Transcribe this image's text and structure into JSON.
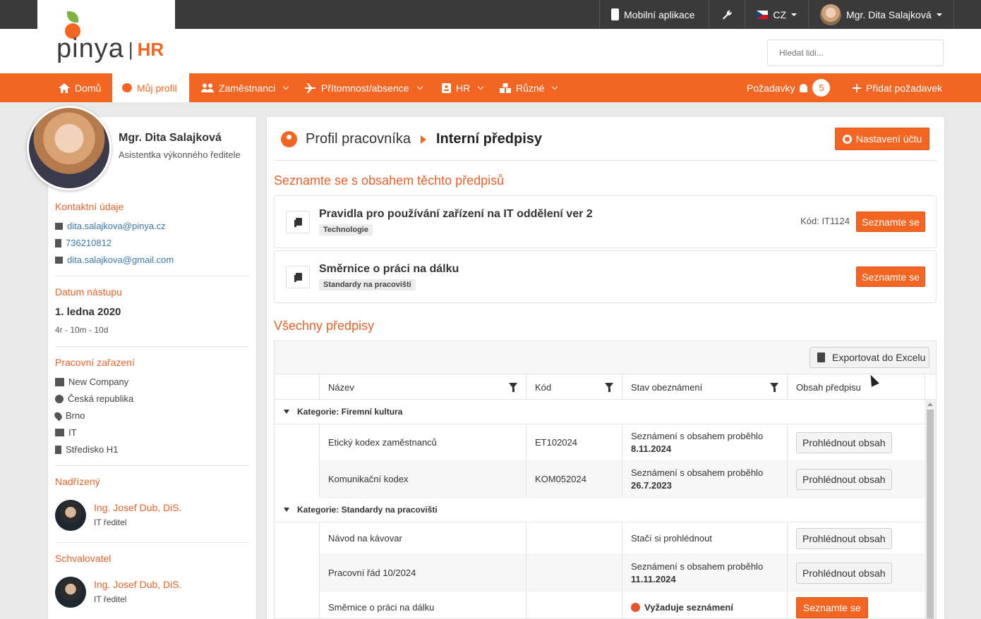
{
  "topbar": {
    "mobile_app": "Mobilní aplikace",
    "language": "CZ",
    "user_name": "Mgr. Dita Salajková"
  },
  "header": {
    "logo_text": "pinya",
    "logo_sep": "|",
    "logo_hr": "HR",
    "search_placeholder": "Hledat lidi..."
  },
  "nav": {
    "items": [
      {
        "label": "Domů"
      },
      {
        "label": "Můj profil"
      },
      {
        "label": "Zaměstnanci"
      },
      {
        "label": "Přítomnost/absence"
      },
      {
        "label": "HR"
      },
      {
        "label": "Různé"
      }
    ],
    "requests_label": "Požadavky",
    "requests_count": "5",
    "add_request_label": "Přidat požadavek",
    "brand_color": "#f26522"
  },
  "profile": {
    "name": "Mgr. Dita Salajková",
    "title": "Asistentka výkonného ředitele",
    "contact_heading": "Kontaktní údaje",
    "email": "dita.salajkova@pinya.cz",
    "phone": "736210812",
    "email_private": "dita.salajkova@gmail.com",
    "start_heading": "Datum nástupu",
    "start_date": "1. ledna 2020",
    "tenure": "4r - 10m - 10d",
    "position_heading": "Pracovní zařazení",
    "company": "New Company",
    "country": "Česká republika",
    "city": "Brno",
    "department": "IT",
    "cost_center": "Středisko H1",
    "manager_heading": "Nadřízený",
    "manager_name": "Ing. Josef Dub, DiS.",
    "manager_role": "IT ředitel",
    "approver_heading": "Schvalovatel",
    "approver_name": "Ing. Josef Dub, DiS.",
    "approver_role": "IT ředitel"
  },
  "main": {
    "crumb1": "Profil pracovníka",
    "crumb2": "Interní předpisy",
    "settings_button": "Nastavení účtu",
    "pending_heading": "Seznamte se s obsahem těchto předpisů",
    "pending": [
      {
        "title": "Pravidla pro používání zařízení na IT oddělení ver 2",
        "tag": "Technologie",
        "code": "Kód: IT1124",
        "button": "Seznamte se"
      },
      {
        "title": "Směrnice o práci na dálku",
        "tag": "Standardy na pracovišti",
        "code": "",
        "button": "Seznamte se"
      }
    ],
    "all_heading": "Všechny předpisy",
    "export_button": "Exportovat do Excelu",
    "columns": [
      "Název",
      "Kód",
      "Stav obeznámení",
      "Obsah předpisu"
    ],
    "categories": [
      {
        "label": "Kategorie: Firemní kultura",
        "rows": [
          {
            "name": "Etický kodex zaměstnanců",
            "code": "ET102024",
            "status_line": "Seznámení s obsahem proběhlo",
            "status_date": "8.11.2024",
            "button": "Prohlédnout obsah"
          },
          {
            "name": "Komunikační kodex",
            "code": "KOM052024",
            "status_line": "Seznámení s obsahem proběhlo",
            "status_date": "26.7.2023",
            "button": "Prohlédnout obsah"
          }
        ]
      },
      {
        "label": "Kategorie: Standardy na pracovišti",
        "rows": [
          {
            "name": "Návod na kávovar",
            "code": "",
            "status_line": "Stačí si prohlédnout",
            "status_date": "",
            "button": "Prohlédnout obsah"
          },
          {
            "name": "Pracovní řád 10/2024",
            "code": "",
            "status_line": "Seznámení s obsahem proběhlo",
            "status_date": "11.11.2024",
            "button": "Prohlédnout obsah"
          },
          {
            "name": "Směrnice o práci na dálku",
            "code": "",
            "status_line": "Vyžaduje seznámení",
            "status_date": "",
            "button": "Seznamte se"
          }
        ]
      }
    ]
  }
}
